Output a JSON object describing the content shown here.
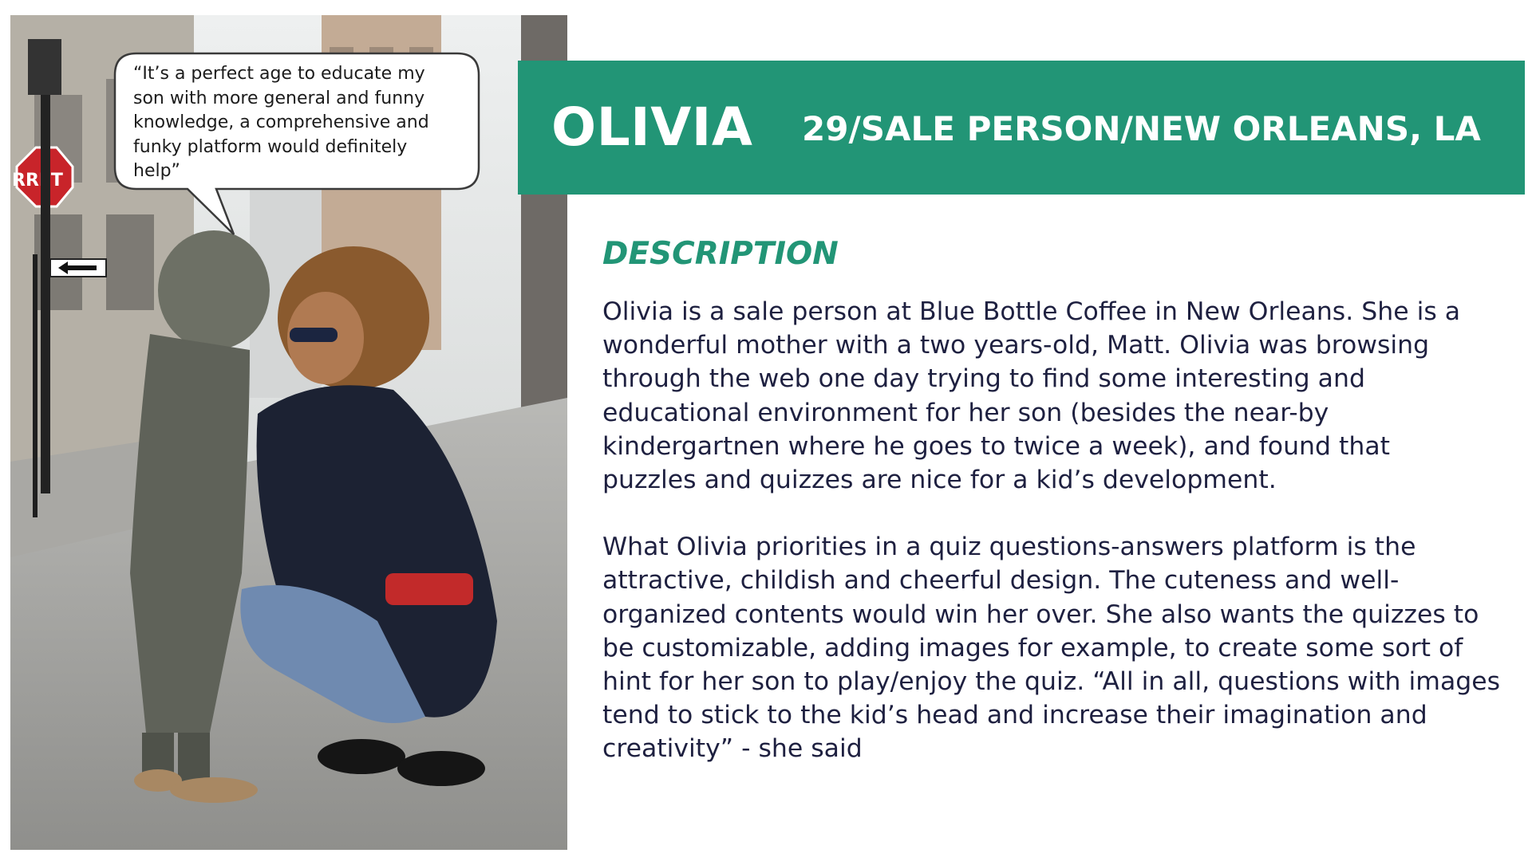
{
  "quote": "“It’s a perfect age to educate my\nson with more general and funny\nknowledge, a comprehensive and\nfunky platform would definitely\nhelp”",
  "banner": {
    "name": "OLIVIA",
    "info": "29/SALE PERSON/NEW ORLEANS, LA"
  },
  "description": {
    "heading": "DESCRIPTION",
    "paragraphs": [
      "Olivia is a sale person at Blue Bottle Coffee in New Orleans. She is a\nwonderful mother with a two years-old, Matt. Olivia was browsing\nthrough the web one day trying to find some interesting and\neducational environment for her son (besides the near-by\nkindergartnen where he goes to twice a week), and found that\npuzzles and quizzes are nice for a kid’s development.",
      "What Olivia priorities in a quiz questions-answers platform is the\nattractive, childish and cheerful design. The cuteness and well-\norganized contents would win her over. She also wants the quizzes to\nbe customizable, adding images for example, to create some sort of\nhint for her son to play/enjoy the quiz. “All in all, questions with images\ntend to stick to the kid’s head and increase their imagination and\ncreativity” - she said"
    ]
  },
  "photo": {
    "sign_text": "RRÊT"
  },
  "colors": {
    "accent": "#229576",
    "body_text": "#1e2040",
    "background": "#ffffff"
  }
}
